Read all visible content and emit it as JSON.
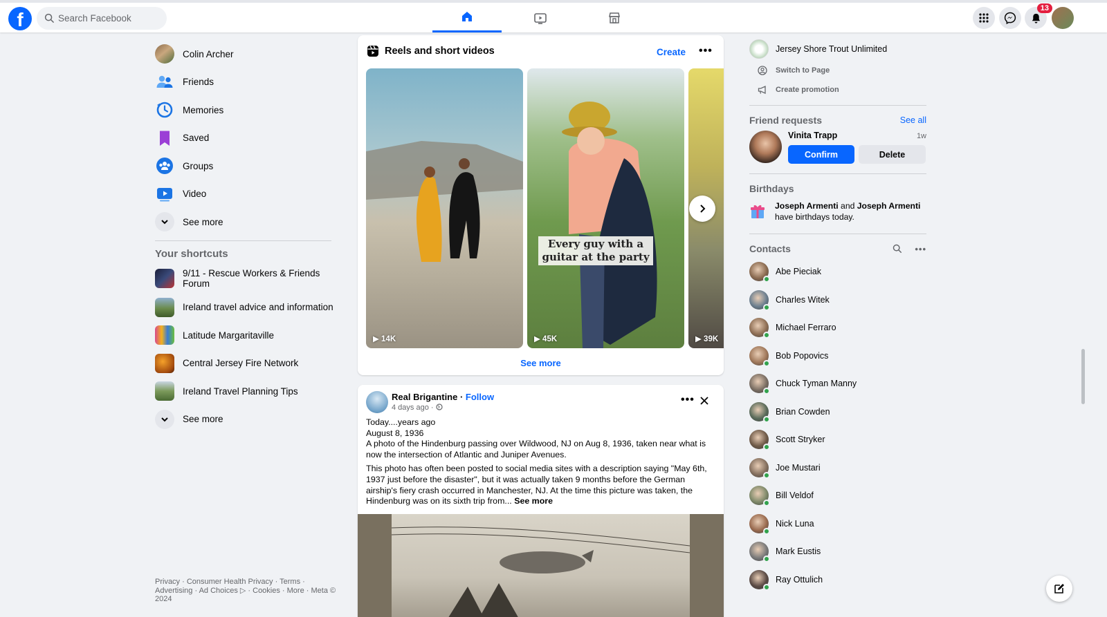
{
  "header": {
    "logo_letter": "f",
    "search_placeholder": "Search Facebook",
    "tabs": [
      "home-icon",
      "video-icon",
      "marketplace-icon"
    ],
    "notifications_count": "13"
  },
  "left_nav": {
    "items": [
      {
        "label": "Colin Archer",
        "icon": "profile-avatar"
      },
      {
        "label": "Friends",
        "icon": "friends-icon"
      },
      {
        "label": "Memories",
        "icon": "memories-icon"
      },
      {
        "label": "Saved",
        "icon": "saved-icon"
      },
      {
        "label": "Groups",
        "icon": "groups-icon"
      },
      {
        "label": "Video",
        "icon": "video-icon"
      }
    ],
    "see_more": "See more",
    "shortcuts_title": "Your shortcuts",
    "shortcuts": [
      {
        "label": "9/11 - Rescue Workers & Friends Forum"
      },
      {
        "label": "Ireland travel advice and information"
      },
      {
        "label": "Latitude Margaritaville"
      },
      {
        "label": "Central Jersey Fire Network"
      },
      {
        "label": "Ireland Travel Planning Tips"
      }
    ],
    "shortcuts_see_more": "See more",
    "footer": "Privacy · Consumer Health Privacy · Terms · Advertising · Ad Choices ▷ · Cookies · More · Meta © 2024"
  },
  "reels": {
    "title": "Reels and short videos",
    "create": "Create",
    "items": [
      {
        "views": "14K"
      },
      {
        "views": "45K",
        "caption": "Every guy with a guitar at the party"
      },
      {
        "views": "39K"
      }
    ],
    "see_more": "See more"
  },
  "post": {
    "author": "Real Brigantine",
    "separator": " · ",
    "follow": "Follow",
    "meta": "4 days ago · ",
    "text_lines": [
      "Today....years ago",
      "August 8, 1936",
      "A photo of the Hindenburg passing over Wildwood, NJ on Aug 8, 1936, taken near what is now the intersection of Atlantic and Juniper Avenues."
    ],
    "paragraph2": "This photo has often been posted to social media sites with a description saying \"May 6th, 1937 just before the disaster\", but it was actually taken 9 months before the German airship's fiery crash occurred in Manchester, NJ. At the time this picture was taken, the Hindenburg was on its sixth trip from...",
    "see_more": "See more"
  },
  "right_col": {
    "page_name": "Jersey Shore Trout Unlimited",
    "switch_to_page": "Switch to Page",
    "create_promotion": "Create promotion",
    "friend_requests_title": "Friend requests",
    "see_all": "See all",
    "request": {
      "name": "Vinita Trapp",
      "time": "1w",
      "confirm": "Confirm",
      "delete": "Delete"
    },
    "birthdays_title": "Birthdays",
    "birthday": {
      "name1": "Joseph Armenti",
      "and": " and ",
      "name2": "Joseph Armenti",
      "suffix": "have birthdays today."
    },
    "contacts_title": "Contacts",
    "contacts": [
      "Abe Pieciak",
      "Charles Witek",
      "Michael Ferraro",
      "Bob Popovics",
      "Chuck Tyman Manny",
      "Brian Cowden",
      "Scott Stryker",
      "Joe Mustari",
      "Bill Veldof",
      "Nick Luna",
      "Mark Eustis",
      "Ray Ottulich"
    ]
  },
  "colors": {
    "accent": "#0866ff",
    "background": "#f0f2f5",
    "badge": "#e41e3f",
    "online": "#31a24c"
  }
}
